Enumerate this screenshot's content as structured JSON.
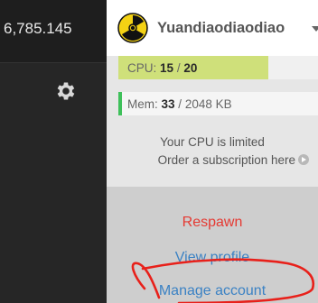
{
  "left": {
    "credits_value": "6,785.145"
  },
  "user": {
    "username": "Yuandiaodiaodiao"
  },
  "cpu": {
    "label": "CPU:",
    "used": "15",
    "separator": " / ",
    "limit": "20",
    "fill_fraction": 0.75
  },
  "mem": {
    "label": "Mem:",
    "used": "33",
    "separator": " / ",
    "limit": "2048 KB"
  },
  "notice": {
    "limited_text": "Your CPU is limited",
    "order_text": "Order a subscription here"
  },
  "menu": {
    "respawn": "Respawn",
    "view_profile": "View profile",
    "manage_account": "Manage account"
  },
  "colors": {
    "cpu_fill": "#cfe07a",
    "mem_accent": "#3ec05a",
    "respawn": "#e53a33",
    "link": "#3b82c4",
    "scribble": "#e8201a"
  },
  "icons": {
    "gear": "gear-icon",
    "avatar": "radiation-icon",
    "caret": "caret-down-icon",
    "order_arrow": "arrow-circle-right-icon"
  }
}
